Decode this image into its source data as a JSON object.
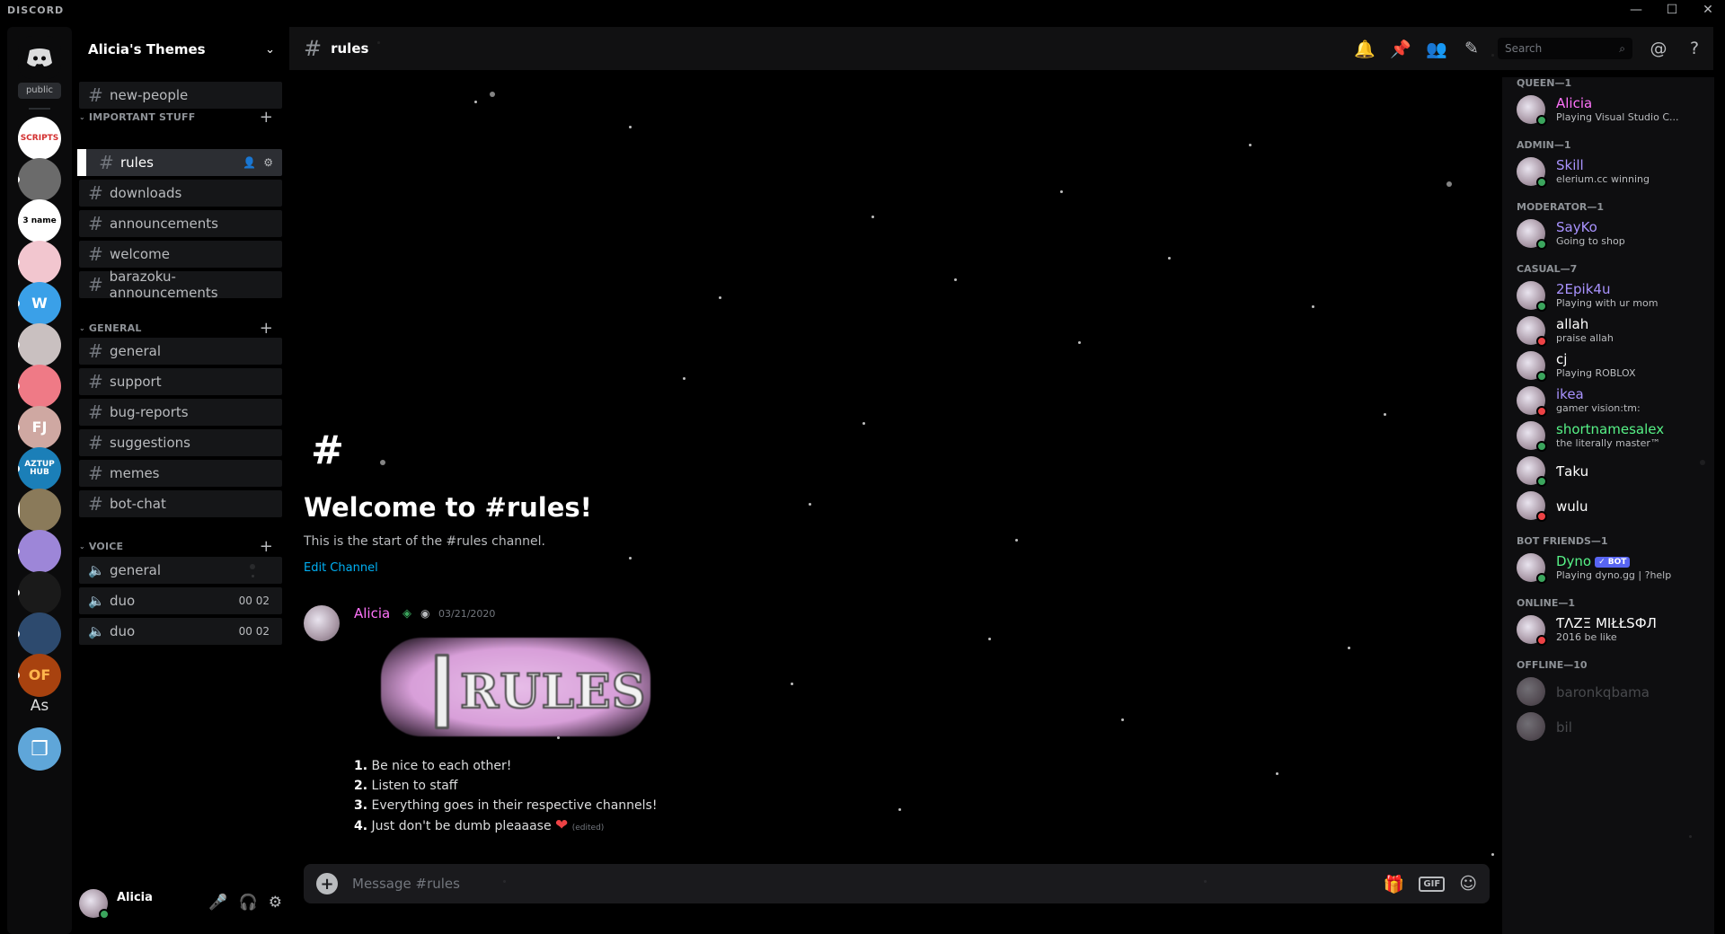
{
  "titlebar": {
    "brand": "DISCORD",
    "minimize": "—",
    "maximize": "☐",
    "close": "✕"
  },
  "colors": {
    "accent": "#5865f2",
    "online": "#3ba55d",
    "dnd": "#ed4245",
    "idle": "#faa81a",
    "link": "#00b0f4"
  },
  "servers": {
    "home_label": "public",
    "text_server": "As",
    "items": [
      {
        "label": "SCRIPTS",
        "color": "#ffffff",
        "text_color": "#d32f2f"
      },
      {
        "label": "",
        "color": "#6b6b6b"
      },
      {
        "label": "3 name",
        "color": "#ffffff",
        "text_color": "#000000"
      },
      {
        "label": "",
        "color": "#f2c6cf"
      },
      {
        "label": "W",
        "color": "#3aa0e8"
      },
      {
        "label": "",
        "color": "#c9c0c0"
      },
      {
        "label": "",
        "color": "#ef7a86"
      },
      {
        "label": "FJ",
        "color": "#cfa8a2"
      },
      {
        "label": "AZTUP HUB",
        "color": "#1b7fb8"
      },
      {
        "label": "",
        "color": "#8a7a5a"
      },
      {
        "label": "",
        "color": "#9d86d8"
      },
      {
        "label": "",
        "color": "#1a1a1a"
      },
      {
        "label": "",
        "color": "#2d4a6e"
      },
      {
        "label": "OF",
        "color": "#a8420f",
        "text_color": "#ffb54c"
      }
    ]
  },
  "sidebar": {
    "server_name": "Alicia's Themes",
    "top_channel": "new-people",
    "categories": [
      {
        "name": "IMPORTANT STUFF",
        "channels": [
          "rules",
          "downloads",
          "announcements",
          "welcome",
          "barazoku-announcements"
        ]
      },
      {
        "name": "GENERAL",
        "channels": [
          "general",
          "support",
          "bug-reports",
          "suggestions",
          "memes",
          "bot-chat"
        ]
      },
      {
        "name": "VOICE",
        "channels": [
          {
            "name": "general",
            "time": ""
          },
          {
            "name": "duo",
            "time": "00 02"
          },
          {
            "name": "duo",
            "time": "00 02"
          }
        ]
      }
    ],
    "selected_channel": "rules",
    "user": {
      "name": "Alicia"
    }
  },
  "header": {
    "channel": "rules",
    "search_placeholder": "Search"
  },
  "chat": {
    "welcome_title": "Welcome to #rules!",
    "welcome_sub": "This is the start of the #rules channel.",
    "edit_channel": "Edit Channel",
    "message": {
      "author": "Alicia",
      "timestamp": "03/21/2020",
      "banner_text": "RULES",
      "rules": [
        {
          "n": "1.",
          "text": "Be nice to each other!"
        },
        {
          "n": "2.",
          "text": "Listen to staff"
        },
        {
          "n": "3.",
          "text": "Everything goes in their respective channels!"
        },
        {
          "n": "4.",
          "text": "Just don't be dumb pleaaase"
        }
      ],
      "edited": "(edited)"
    },
    "composer_placeholder": "Message #rules",
    "gif_label": "GIF"
  },
  "members": {
    "groups": [
      {
        "title": "QUEEN—1",
        "members": [
          {
            "name": "Alicia",
            "sub": "Playing Visual Studio C...",
            "color": "#ff73fa",
            "status": "online"
          }
        ]
      },
      {
        "title": "ADMIN—1",
        "members": [
          {
            "name": "Skill",
            "sub": "elerium.cc winning",
            "color": "#a993ff",
            "status": "online"
          }
        ]
      },
      {
        "title": "MODERATOR—1",
        "members": [
          {
            "name": "SayKo",
            "sub": "Going to shop",
            "color": "#a993ff",
            "status": "online"
          }
        ]
      },
      {
        "title": "CASUAL—7",
        "members": [
          {
            "name": "2Epik4u",
            "sub": "Playing with ur mom",
            "color": "#a993ff",
            "status": "online"
          },
          {
            "name": "allah",
            "sub": "praise allah",
            "color": "#ffffff",
            "status": "dnd"
          },
          {
            "name": "cj",
            "sub": "Playing ROBLOX",
            "color": "#ffffff",
            "status": "online"
          },
          {
            "name": "ikea",
            "sub": "gamer vision:tm:",
            "color": "#a993ff",
            "status": "dnd"
          },
          {
            "name": "shortnamesalex",
            "sub": "the literally master™",
            "color": "#57f287",
            "status": "online"
          },
          {
            "name": "Ƭaku",
            "sub": "",
            "color": "#ffffff",
            "status": "online"
          },
          {
            "name": "wulu",
            "sub": "",
            "color": "#ffffff",
            "status": "dnd"
          }
        ]
      },
      {
        "title": "BOT FRIENDS—1",
        "members": [
          {
            "name": "Dyno",
            "sub": "Playing dyno.gg | ?help",
            "color": "#57f287",
            "status": "online",
            "bot": "✓ BOT"
          }
        ]
      },
      {
        "title": "ONLINE—1",
        "members": [
          {
            "name": "ƬΛZΞ MIŁŁSФЛ",
            "sub": "2016 be like",
            "color": "#ffffff",
            "status": "dnd"
          }
        ]
      },
      {
        "title": "OFFLINE—10",
        "members": [
          {
            "name": "baronkqbama",
            "sub": "",
            "color": "#8e9297",
            "status": "offline"
          },
          {
            "name": "bil",
            "sub": "",
            "color": "#8e9297",
            "status": "offline"
          }
        ]
      }
    ]
  }
}
